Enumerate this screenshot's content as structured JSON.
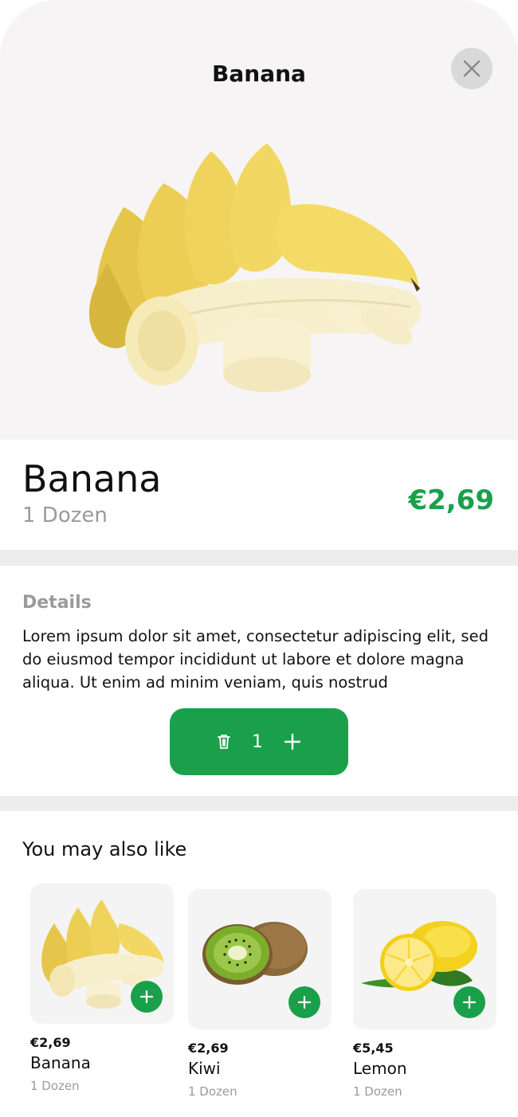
{
  "header": {
    "title": "Banana"
  },
  "icons": {
    "close": "close-icon",
    "delete": "trash-icon",
    "add": "plus-icon"
  },
  "product": {
    "name": "Banana",
    "unit": "1 Dozen",
    "price": "€2,69"
  },
  "details": {
    "title": "Details",
    "text": "Lorem ipsum dolor sit amet, consectetur adipiscing elit, sed do eiusmod tempor incididunt ut labore et dolore magna aliqua. Ut enim ad minim veniam, quis nostrud"
  },
  "quantity": {
    "count": "1"
  },
  "similar": {
    "title": "You may also like",
    "items": [
      {
        "price": "€2,69",
        "name": "Banana",
        "unit": "1 Dozen"
      },
      {
        "price": "€2,69",
        "name": "Kiwi",
        "unit": "1 Dozen"
      },
      {
        "price": "€5,45",
        "name": "Lemon",
        "unit": "1 Dozen"
      }
    ]
  },
  "colors": {
    "accent": "#1aa04b",
    "hero_bg": "#f6f4f4",
    "divider": "#ededed",
    "muted": "#9a9a9a"
  }
}
